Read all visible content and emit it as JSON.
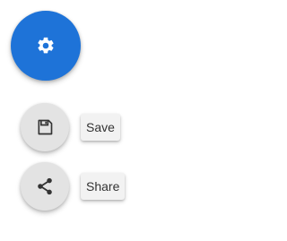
{
  "speed_dial": {
    "main_button": {
      "icon": "gear-icon",
      "color": "#1e73d8",
      "icon_color": "#ffffff"
    },
    "actions": [
      {
        "label": "Save",
        "icon": "floppy-disk-icon"
      },
      {
        "label": "Share",
        "icon": "share-icon"
      }
    ],
    "action_button_color": "#e3e3e3",
    "action_icon_color": "#333333"
  }
}
